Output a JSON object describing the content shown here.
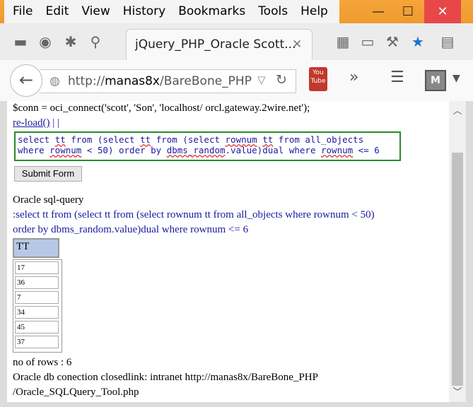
{
  "menubar": {
    "items": [
      "File",
      "Edit",
      "View",
      "History",
      "Bookmarks",
      "Tools",
      "Help"
    ]
  },
  "window_controls": {
    "minimize": "—",
    "maximize": "☐",
    "close": "✕"
  },
  "tab": {
    "title": "jQuery_PHP_Oracle Scott...",
    "close": "✕"
  },
  "navbar": {
    "url_prefix": "http://",
    "url_host": "manas8x",
    "url_path": "/BareBone_PHP/(",
    "youtube_label": "You Tube"
  },
  "content": {
    "conn_line": "$conn = oci_connect('scott', 'Son', 'localhost/ orcl.gateway.2wire.net');",
    "reload_link": "re-load()",
    "reload_sep": " | |",
    "sql_line1_parts": [
      "select ",
      "tt",
      " from (select ",
      "tt",
      " from (select ",
      "rownum",
      " ",
      "tt",
      " from all_objects"
    ],
    "sql_line2_parts": [
      "where ",
      "rownum",
      " < 50) order by ",
      "dbms_random",
      ".value)dual where ",
      "rownum",
      " <= ",
      "6"
    ],
    "submit_label": "Submit Form",
    "query_heading": "Oracle sql-query",
    "query_line1": ":select tt from (select tt from (select rownum tt from all_objects where rownum < 50)",
    "query_line2": "order by dbms_random.value)dual where rownum <= 6",
    "table_header": "TT",
    "rows": [
      "17",
      "36",
      "7",
      "34",
      "45",
      "37"
    ],
    "row_count": "no of rows : 6",
    "footer_line1": "Oracle db conection closedlink: intranet http://manas8x/BareBone_PHP",
    "footer_line2": "/Oracle_SQLQuery_Tool.php"
  },
  "colors": {
    "accent_orange": "#f0a830",
    "close_red": "#e8474a",
    "link_blue": "#1a1aa0",
    "sql_border_green": "#2a8a2a",
    "table_header_blue": "#b6c8e6"
  }
}
